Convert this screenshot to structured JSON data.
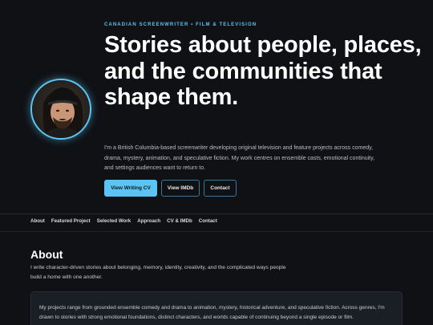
{
  "hero": {
    "eyebrow": "CANADIAN SCREENWRITER • FILM & TELEVISION",
    "headline": "Stories about people, places, and the communities that shape them.",
    "intro": "I'm a British Columbia-based screenwriter developing original television and feature projects across comedy, drama, mystery, animation, and speculative fiction. My work centres on ensemble casts, emotional continuity, and settings audiences want to return to.",
    "buttons": {
      "cv": "View Writing CV",
      "imdb": "View IMDb",
      "contact": "Contact"
    }
  },
  "nav": {
    "items": [
      "About",
      "Featured Project",
      "Selected Work",
      "Approach",
      "CV & IMDb",
      "Contact"
    ]
  },
  "about": {
    "title": "About",
    "lead": "I write character-driven stories about belonging, memory, identity, creativity, and the complicated ways people build a home with one another.",
    "card_text": "My projects range from grounded ensemble comedy and drama to animation, mystery, historical adventure, and speculative fiction. Across genres, I'm drawn to stories with strong emotional foundations, distinct characters, and worlds capable of continuing beyond a single episode or film."
  },
  "colors": {
    "accent": "#5bc4f2",
    "background": "#0f1115",
    "card": "#1a1e25"
  }
}
